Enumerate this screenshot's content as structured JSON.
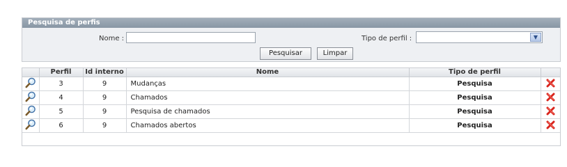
{
  "search_panel": {
    "title": "Pesquisa de perfis",
    "nome_label": "Nome :",
    "nome_value": "",
    "tipo_label": "Tipo de perfil :",
    "tipo_selected": "",
    "search_button": "Pesquisar",
    "clear_button": "Limpar"
  },
  "results": {
    "columns": [
      "",
      "Perfil",
      "Id interno",
      "Nome",
      "Tipo de perfil",
      ""
    ],
    "rows": [
      {
        "perfil": "3",
        "id": "9",
        "nome": "Mudanças",
        "tipo": "Pesquisa"
      },
      {
        "perfil": "4",
        "id": "9",
        "nome": "Chamados",
        "tipo": "Pesquisa"
      },
      {
        "perfil": "5",
        "id": "9",
        "nome": "Pesquisa de chamados",
        "tipo": "Pesquisa"
      },
      {
        "perfil": "6",
        "id": "9",
        "nome": "Chamados abertos",
        "tipo": "Pesquisa"
      }
    ],
    "row_icons": {
      "view": "magnifier-icon",
      "delete": "red-x-delete-icon"
    }
  },
  "colors": {
    "panel_header": "#8896a4",
    "panel_bg": "#eef0f3",
    "delete_red": "#d9241c"
  }
}
